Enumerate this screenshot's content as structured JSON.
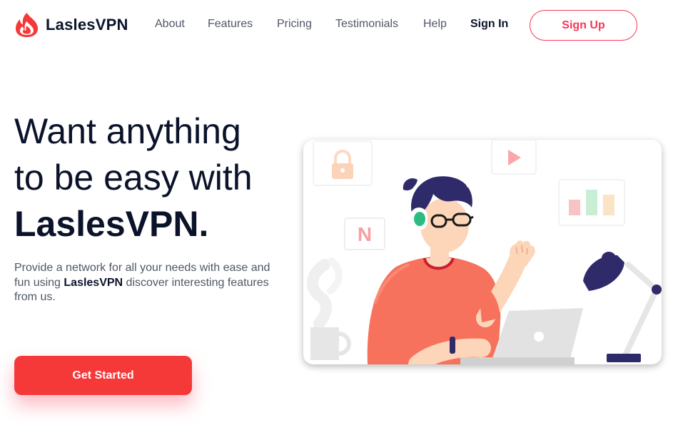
{
  "brand": {
    "name": "LaslesVPN",
    "icon": "flame-logo-icon",
    "color": "#f53838"
  },
  "nav": {
    "links": [
      "About",
      "Features",
      "Pricing",
      "Testimonials",
      "Help"
    ],
    "sign_in": "Sign In",
    "sign_up": "Sign Up"
  },
  "hero": {
    "title_line1": "Want anything",
    "title_line2": "to be easy with",
    "title_line3": "LaslesVPN.",
    "desc_before": "Provide a network for all your needs with ease and fun using ",
    "desc_brand": "LaslesVPN",
    "desc_after": " discover interesting features from us.",
    "cta_label": "Get Started"
  },
  "illustration": {
    "tiles": [
      "lock-icon",
      "play-icon",
      "bar-chart-icon",
      "netflix-icon"
    ],
    "tile_letter": "N",
    "colors": {
      "shirt": "#f7725d",
      "hair": "#2f2b6b",
      "skin": "#fdd5b8",
      "lamp": "#2f2b6b"
    }
  },
  "colors": {
    "accent": "#f53838",
    "text_dark": "#0b132a",
    "text_muted": "#4f5665"
  }
}
